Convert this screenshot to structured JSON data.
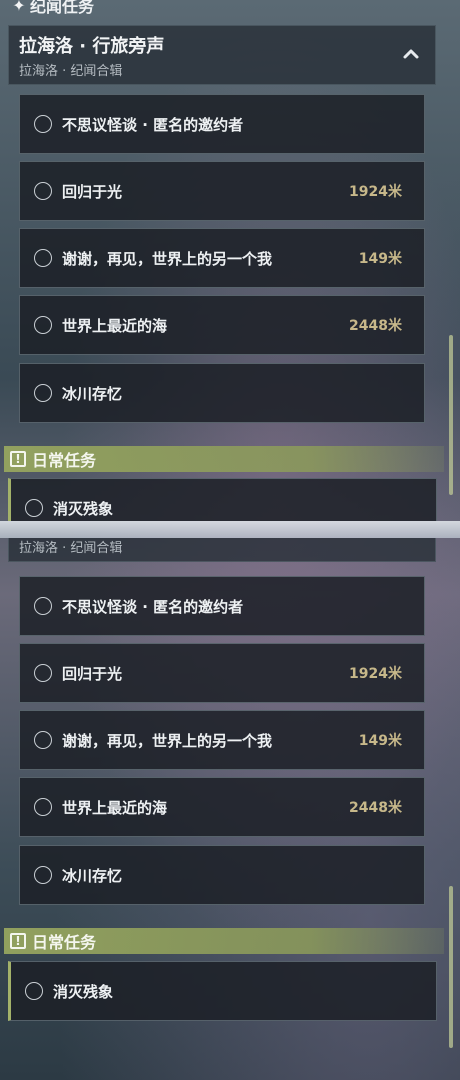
{
  "story_section": {
    "title": "纪闻任务",
    "icon": "sparkle-icon"
  },
  "group": {
    "title": "拉海洛 · 行旅旁声",
    "subtitle": "拉海洛 · 纪闻合辑",
    "toggle_icon": "chevron-up-icon"
  },
  "quests": [
    {
      "name": "不思议怪谈 · 匿名的邀约者",
      "distance": ""
    },
    {
      "name": "回归于光",
      "distance": "1924米"
    },
    {
      "name": "谢谢，再见，世界上的另一个我",
      "distance": "149米"
    },
    {
      "name": "世界上最近的海",
      "distance": "2448米"
    },
    {
      "name": "冰川存忆",
      "distance": ""
    }
  ],
  "daily_section": {
    "title": "日常任务",
    "icon": "exclamation-icon"
  },
  "daily_quests": [
    {
      "name": "消灭残象"
    }
  ],
  "colors": {
    "accent": "#a3b26a",
    "distance": "#c7b88a",
    "panel": "#1c2026"
  }
}
